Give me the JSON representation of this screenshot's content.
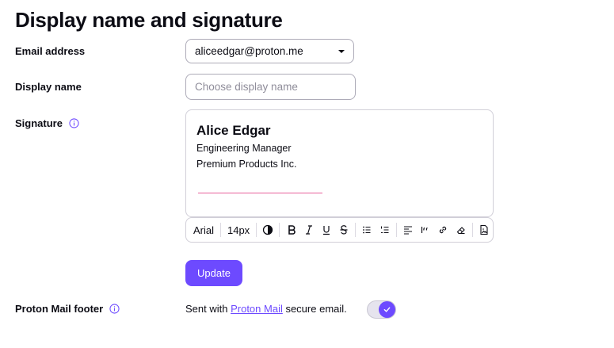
{
  "page": {
    "title": "Display name and signature"
  },
  "email": {
    "label": "Email address",
    "value": "aliceedgar@proton.me"
  },
  "display_name": {
    "label": "Display name",
    "placeholder": "Choose display name"
  },
  "signature": {
    "label": "Signature",
    "name": "Alice Edgar",
    "lines": [
      "Engineering Manager",
      "Premium Products Inc."
    ]
  },
  "toolbar": {
    "font": "Arial",
    "size": "14px"
  },
  "update_label": "Update",
  "footer": {
    "label": "Proton Mail footer",
    "prefix": "Sent with ",
    "link": "Proton Mail",
    "suffix": " secure email.",
    "enabled": true
  },
  "colors": {
    "accent": "#6d4aff",
    "rule": "#e8609a"
  }
}
